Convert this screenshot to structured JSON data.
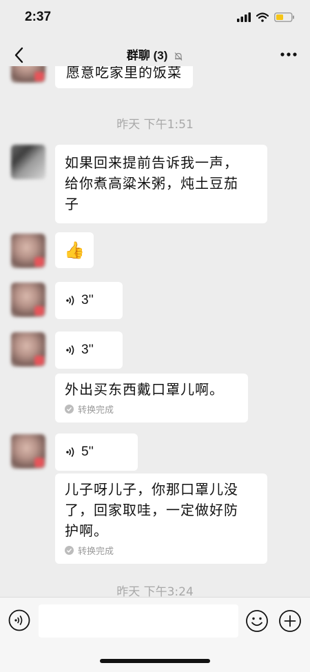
{
  "status_bar": {
    "time": "2:37"
  },
  "nav": {
    "title": "群聊 (3)"
  },
  "messages": {
    "m0": {
      "text": "愿意吃家里的饭菜"
    },
    "ts1": "昨天 下午1:51",
    "m1": {
      "line1": "如果回来提前告诉我一声，",
      "line2": "给你煮高粱米粥，炖土豆茄",
      "line3": "子"
    },
    "m2": {
      "emoji": "👍"
    },
    "m3": {
      "duration": "3''"
    },
    "m4": {
      "duration": "3''",
      "transcript": "外出买东西戴口罩儿啊。",
      "status": "转换完成"
    },
    "m5": {
      "duration": "5''",
      "line1": "儿子呀儿子，你那口罩儿没",
      "line2": "了，回家取哇，一定做好防",
      "line3": "护啊。",
      "status": "转换完成"
    },
    "ts2": "昨天 下午3:24"
  },
  "input": {
    "placeholder": ""
  },
  "colors": {
    "background": "#ededed",
    "bubble": "#ffffff",
    "input_bar": "#f6f6f6",
    "battery": "#f5c518"
  }
}
